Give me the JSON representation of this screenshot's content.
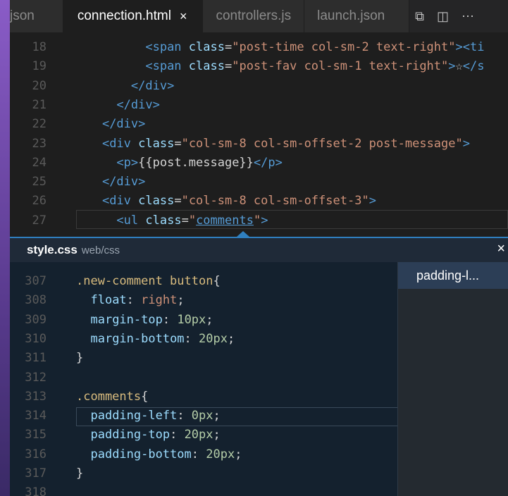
{
  "tabs": [
    {
      "label": "json",
      "active": false
    },
    {
      "label": "connection.html",
      "active": true,
      "close": "×"
    },
    {
      "label": "controllers.js",
      "active": false
    },
    {
      "label": "launch.json",
      "active": false
    }
  ],
  "tab_actions": {
    "compare_icon": "⧉",
    "split_icon": "◫",
    "more_icon": "⋯"
  },
  "editor_top": {
    "lines": [
      {
        "n": "18",
        "indent": "          ",
        "parts": [
          [
            "tag",
            "<span "
          ],
          [
            "attr",
            "class"
          ],
          [
            "txt",
            "="
          ],
          [
            "str",
            "\"post-time col-sm-2 text-right\""
          ],
          [
            "tag",
            "><ti"
          ]
        ]
      },
      {
        "n": "19",
        "indent": "          ",
        "parts": [
          [
            "tag",
            "<span "
          ],
          [
            "attr",
            "class"
          ],
          [
            "txt",
            "="
          ],
          [
            "str",
            "\"post-fav col-sm-1 text-right\""
          ],
          [
            "tag",
            ">"
          ],
          [
            "txt",
            "☆"
          ],
          [
            "tag",
            "</s"
          ]
        ]
      },
      {
        "n": "20",
        "indent": "        ",
        "parts": [
          [
            "tag",
            "</div>"
          ]
        ]
      },
      {
        "n": "21",
        "indent": "      ",
        "parts": [
          [
            "tag",
            "</div>"
          ]
        ]
      },
      {
        "n": "22",
        "indent": "    ",
        "parts": [
          [
            "tag",
            "</div>"
          ]
        ]
      },
      {
        "n": "23",
        "indent": "    ",
        "parts": [
          [
            "tag",
            "<div "
          ],
          [
            "attr",
            "class"
          ],
          [
            "txt",
            "="
          ],
          [
            "str",
            "\"col-sm-8 col-sm-offset-2 post-message\""
          ],
          [
            "tag",
            ">"
          ]
        ]
      },
      {
        "n": "24",
        "indent": "      ",
        "parts": [
          [
            "tag",
            "<p>"
          ],
          [
            "txt",
            "{{post.message}}"
          ],
          [
            "tag",
            "</p>"
          ]
        ]
      },
      {
        "n": "25",
        "indent": "    ",
        "parts": [
          [
            "tag",
            "</div>"
          ]
        ]
      },
      {
        "n": "26",
        "indent": "    ",
        "parts": [
          [
            "tag",
            "<div "
          ],
          [
            "attr",
            "class"
          ],
          [
            "txt",
            "="
          ],
          [
            "str",
            "\"col-sm-8 col-sm-offset-3\""
          ],
          [
            "tag",
            ">"
          ]
        ]
      },
      {
        "n": "27",
        "indent": "      ",
        "parts": [
          [
            "tag",
            "<ul "
          ],
          [
            "attr",
            "class"
          ],
          [
            "txt",
            "="
          ],
          [
            "str",
            "\""
          ],
          [
            "link",
            "comments"
          ],
          [
            "str",
            "\""
          ],
          [
            "tag",
            ">"
          ]
        ]
      }
    ]
  },
  "peek": {
    "file": "style.css",
    "path": "web/css",
    "close": "×",
    "reference": "padding-l...",
    "lines": [
      {
        "n": "307",
        "parts": [
          [
            "sel",
            ".new-comment button"
          ],
          [
            "txt",
            "{"
          ]
        ]
      },
      {
        "n": "308",
        "parts": [
          [
            "txt",
            "  "
          ],
          [
            "prop",
            "float"
          ],
          [
            "txt",
            ": "
          ],
          [
            "val",
            "right"
          ],
          [
            "txt",
            ";"
          ]
        ]
      },
      {
        "n": "309",
        "parts": [
          [
            "txt",
            "  "
          ],
          [
            "prop",
            "margin-top"
          ],
          [
            "txt",
            ": "
          ],
          [
            "num",
            "10px"
          ],
          [
            "txt",
            ";"
          ]
        ]
      },
      {
        "n": "310",
        "parts": [
          [
            "txt",
            "  "
          ],
          [
            "prop",
            "margin-bottom"
          ],
          [
            "txt",
            ": "
          ],
          [
            "num",
            "20px"
          ],
          [
            "txt",
            ";"
          ]
        ]
      },
      {
        "n": "311",
        "parts": [
          [
            "txt",
            "}"
          ]
        ]
      },
      {
        "n": "312",
        "parts": []
      },
      {
        "n": "313",
        "parts": [
          [
            "sel",
            ".comments"
          ],
          [
            "txt",
            "{"
          ]
        ]
      },
      {
        "n": "314",
        "parts": [
          [
            "txt",
            "  "
          ],
          [
            "prop",
            "padding-left"
          ],
          [
            "txt",
            ": "
          ],
          [
            "num",
            "0px"
          ],
          [
            "txt",
            ";"
          ]
        ]
      },
      {
        "n": "315",
        "parts": [
          [
            "txt",
            "  "
          ],
          [
            "prop",
            "padding-top"
          ],
          [
            "txt",
            ": "
          ],
          [
            "num",
            "20px"
          ],
          [
            "txt",
            ";"
          ]
        ]
      },
      {
        "n": "316",
        "parts": [
          [
            "txt",
            "  "
          ],
          [
            "prop",
            "padding-bottom"
          ],
          [
            "txt",
            ": "
          ],
          [
            "num",
            "20px"
          ],
          [
            "txt",
            ";"
          ]
        ]
      },
      {
        "n": "317",
        "parts": [
          [
            "txt",
            "}"
          ]
        ]
      },
      {
        "n": "318",
        "parts": []
      }
    ]
  }
}
